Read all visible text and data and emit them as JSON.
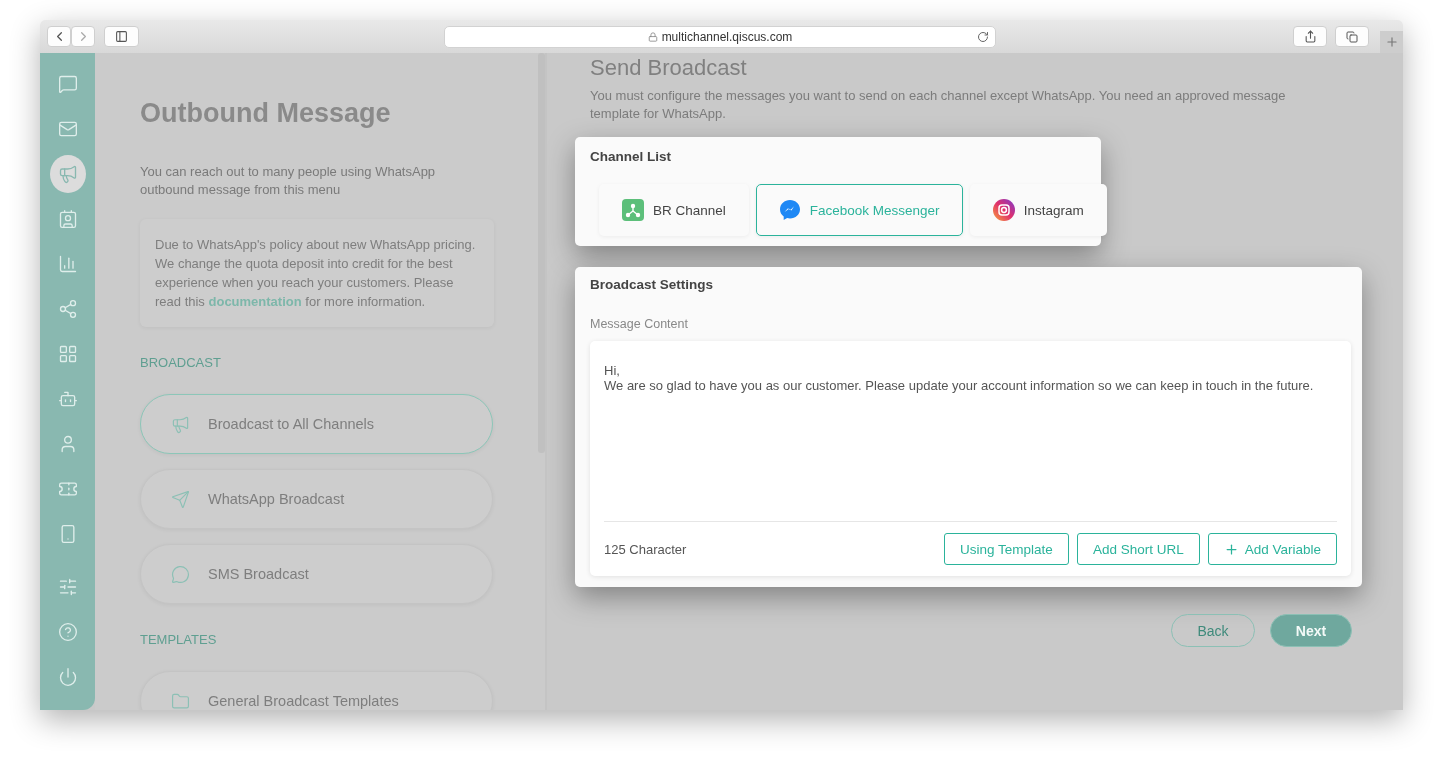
{
  "browser": {
    "url": "multichannel.qiscus.com"
  },
  "sidebar": {
    "items": [
      {
        "selected": false
      },
      {
        "selected": false
      },
      {
        "selected": true
      },
      {
        "selected": false
      },
      {
        "selected": false
      },
      {
        "selected": false
      },
      {
        "selected": false
      },
      {
        "selected": false
      },
      {
        "selected": false
      },
      {
        "selected": false
      },
      {
        "selected": false
      },
      {
        "selected": false
      },
      {
        "selected": false
      },
      {
        "selected": false
      }
    ]
  },
  "left_panel": {
    "title": "Outbound Message",
    "description": "You can reach out to many people using WhatsApp outbound message from this menu",
    "notice": {
      "text": "Due to WhatsApp's policy about new WhatsApp pricing. We change the quota deposit into credit for the best experience when you reach your customers. Please read this",
      "link": "documentation",
      "after": "for more information."
    },
    "sections": [
      {
        "heading": "BROADCAST",
        "items": [
          {
            "label": "Broadcast to All Channels",
            "kind": "megaphone",
            "selected": true
          },
          {
            "label": "WhatsApp Broadcast",
            "kind": "send",
            "selected": false
          },
          {
            "label": "SMS Broadcast",
            "kind": "sms",
            "selected": false
          }
        ]
      },
      {
        "heading": "TEMPLATES",
        "items": [
          {
            "label": "General Broadcast Templates",
            "kind": "folder",
            "selected": false
          }
        ]
      }
    ]
  },
  "main": {
    "title": "Send Broadcast",
    "description": "You must configure the messages you want to send on each channel except WhatsApp. You need an approved message template for WhatsApp.",
    "channel_list": {
      "title": "Channel List",
      "channels": [
        {
          "label": "BR Channel",
          "kind": "br",
          "selected": false
        },
        {
          "label": "Facebook Messenger",
          "kind": "messenger",
          "selected": true
        },
        {
          "label": "Instagram",
          "kind": "instagram",
          "selected": false
        }
      ]
    },
    "broadcast_settings": {
      "title": "Broadcast Settings",
      "field_label": "Message Content",
      "message": "Hi,\nWe are so glad to have you as our customer. Please update your account information so we can keep in touch in the future.",
      "counter": "125 Character",
      "actions": [
        {
          "label": "Using Template",
          "kind": "plain"
        },
        {
          "label": "Add Short URL",
          "kind": "plain"
        },
        {
          "label": "Add Variable",
          "kind": "add"
        }
      ]
    },
    "nav_buttons": [
      {
        "label": "Back",
        "kind": "secondary"
      },
      {
        "label": "Next",
        "kind": "primary"
      }
    ]
  }
}
